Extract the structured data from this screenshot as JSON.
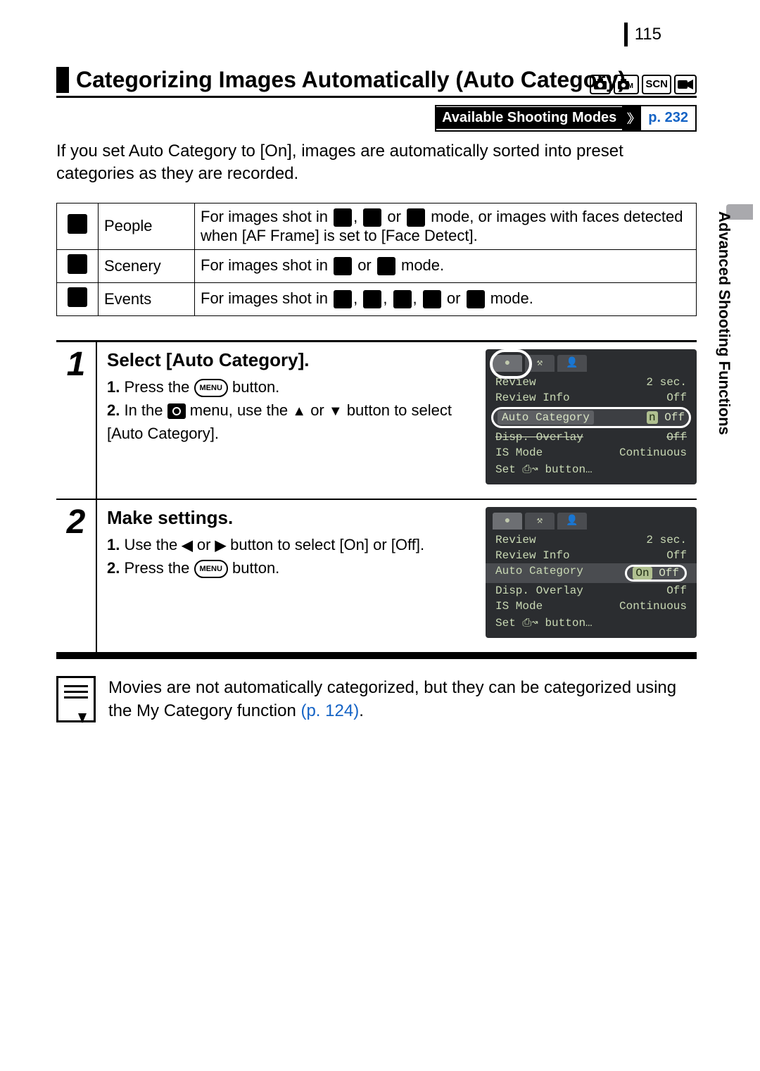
{
  "page_number": "115",
  "side_label": "Advanced Shooting Functions",
  "title": "Categorizing Images Automatically (Auto Category)",
  "mode_boxes": [
    "camera",
    "camera-m",
    "SCN",
    "movie"
  ],
  "modes_bar": {
    "label": "Available Shooting Modes",
    "page_ref": "p. 232"
  },
  "intro_text": "If you set Auto Category to [On], images are automatically sorted into preset categories as they are recorded.",
  "categories": [
    {
      "icon": "people-icon",
      "name": "People",
      "desc_pre": "For images shot in ",
      "desc_icons": [
        "portrait-mode-icon",
        "foliage-mode-icon",
        "night-snapshot-mode-icon"
      ],
      "desc_joins": [
        ", ",
        " or "
      ],
      "desc_post": " mode, or images with faces detected when [AF Frame] is set to [Face Detect]."
    },
    {
      "icon": "scenery-icon",
      "name": "Scenery",
      "desc_pre": "For images shot in ",
      "desc_icons": [
        "landscape-mode-icon",
        "sunset-mode-icon"
      ],
      "desc_joins": [
        " or "
      ],
      "desc_post": " mode."
    },
    {
      "icon": "events-icon",
      "name": "Events",
      "desc_pre": "For images shot in ",
      "desc_icons": [
        "kids-pets-mode-icon",
        "party-mode-icon",
        "sports-mode-icon",
        "fireworks-mode-icon",
        "aquarium-mode-icon"
      ],
      "desc_joins": [
        ", ",
        ", ",
        ", ",
        " or "
      ],
      "desc_post": " mode."
    }
  ],
  "steps": [
    {
      "num": "1",
      "title": "Select [Auto Category].",
      "lines": [
        {
          "n": "1.",
          "pre": "Press the ",
          "btn": "MENU",
          "post": " button."
        },
        {
          "n": "2.",
          "pre": "In the ",
          "cam": true,
          "mid": " menu, use the ",
          "arrows": [
            "▲",
            "▼"
          ],
          "arrow_join": " or ",
          "post": " button to select [Auto Category]."
        }
      ],
      "lcd": {
        "tab_circle": true,
        "highlight_row": {
          "label": "Auto Category",
          "value_prefix": "n",
          "value": "Off"
        },
        "rows": [
          {
            "label": "Review",
            "value": "2 sec."
          },
          {
            "label": "Review Info",
            "value": "Off"
          },
          {
            "label": "Disp. Overlay",
            "value": "Off",
            "strike": true
          },
          {
            "label": "IS Mode",
            "value": "Continuous"
          },
          {
            "label": "Set ⎙↝ button…",
            "value": ""
          }
        ]
      }
    },
    {
      "num": "2",
      "title": "Make settings.",
      "lines": [
        {
          "n": "1.",
          "pre": "Use the ",
          "arrows": [
            "◀",
            "▶"
          ],
          "arrow_join": " or ",
          "post": " button to select [On] or [Off]."
        },
        {
          "n": "2.",
          "pre": "Press the ",
          "btn": "MENU",
          "post": " button."
        }
      ],
      "lcd": {
        "tab_circle": false,
        "highlight_on_off": {
          "label": "Auto Category",
          "on": "On",
          "off": "Off"
        },
        "rows": [
          {
            "label": "Review",
            "value": "2 sec."
          },
          {
            "label": "Review Info",
            "value": "Off"
          },
          {
            "label": "Disp. Overlay",
            "value": "Off"
          },
          {
            "label": "IS Mode",
            "value": "Continuous"
          },
          {
            "label": "Set ⎙↝ button…",
            "value": ""
          }
        ]
      }
    }
  ],
  "note": {
    "text": "Movies are not automatically categorized, but they can be categorized using the My Category function ",
    "link": "(p. 124)",
    "tail": "."
  }
}
